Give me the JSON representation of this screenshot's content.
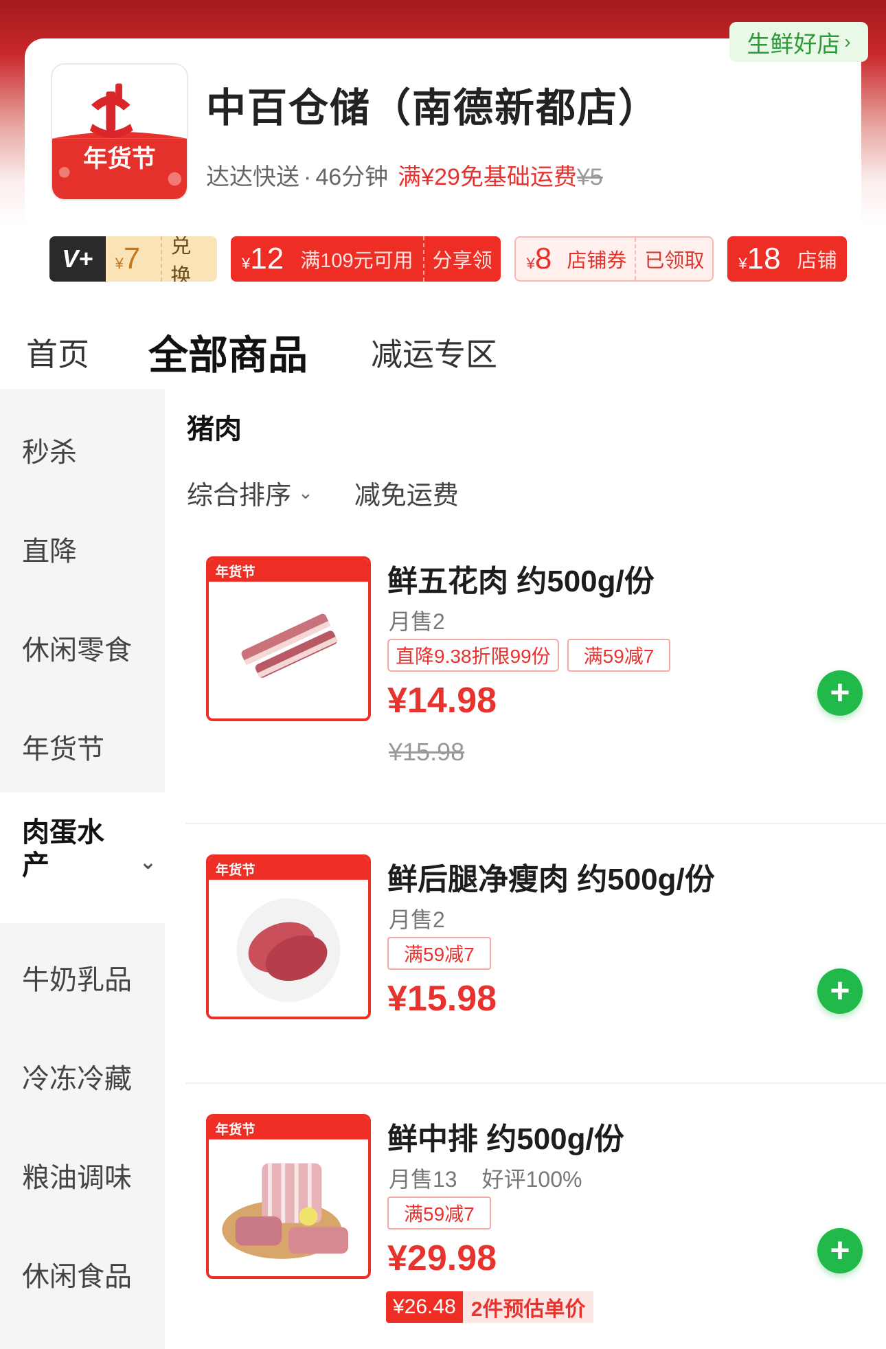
{
  "store": {
    "badge": "生鲜好店",
    "name": "中百仓储（南德新都店）",
    "logo_text": "年货节",
    "delivery_provider": "达达快送",
    "separator": "·",
    "delivery_time": "46分钟",
    "free_shipping": "满¥29免基础运费",
    "old_fee": "¥5"
  },
  "coupons": [
    {
      "tag": "V+",
      "currency": "¥",
      "amount": "7",
      "action": "兑换"
    },
    {
      "currency": "¥",
      "amount": "12",
      "desc": "满109元可用",
      "action": "分享领"
    },
    {
      "currency": "¥",
      "amount": "8",
      "desc": "店铺券",
      "action": "已领取"
    },
    {
      "currency": "¥",
      "amount": "18",
      "desc": "店铺"
    }
  ],
  "tabs": [
    {
      "label": "首页"
    },
    {
      "label": "全部商品",
      "active": true
    },
    {
      "label": "减运专区"
    }
  ],
  "sidebar": [
    {
      "label": "秒杀"
    },
    {
      "label": "直降"
    },
    {
      "label": "休闲零食"
    },
    {
      "label": "年货节"
    },
    {
      "label": "肉蛋水产",
      "active": true
    },
    {
      "label": "牛奶乳品"
    },
    {
      "label": "冷冻冷藏"
    },
    {
      "label": "粮油调味"
    },
    {
      "label": "休闲食品"
    }
  ],
  "content": {
    "category_title": "猪肉",
    "sort_label": "综合排序",
    "filter_label": "减免运费"
  },
  "products": [
    {
      "name": "鲜五花肉 约500g/份",
      "sales": "月售2",
      "tags": [
        "直降9.38折限99份",
        "满59减7"
      ],
      "price": "¥14.98",
      "old_price": "¥15.98",
      "image": "pork-belly",
      "banner": "年货节"
    },
    {
      "name": "鲜后腿净瘦肉 约500g/份",
      "sales": "月售2",
      "tags": [
        "满59减7"
      ],
      "price": "¥15.98",
      "image": "lean-pork",
      "banner": "年货节"
    },
    {
      "name": "鲜中排 约500g/份",
      "sales": "月售13",
      "rating": "好评100%",
      "tags": [
        "满59减7"
      ],
      "price": "¥29.98",
      "estimate_value": "¥26.48",
      "estimate_label": "2件预估单价",
      "image": "pork-ribs",
      "banner": "年货节"
    }
  ],
  "colors": {
    "accent_red": "#ee2d25",
    "accent_green": "#21b94a",
    "tab_underline": "#3fd15a"
  }
}
